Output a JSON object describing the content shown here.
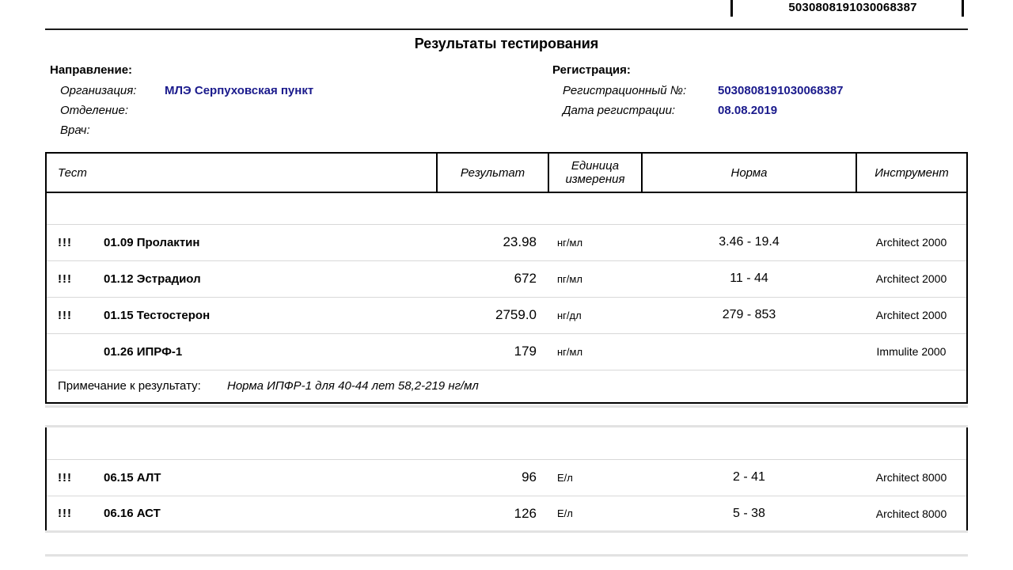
{
  "document": {
    "title": "Результаты тестирования",
    "barcode_number": "5030808191030068387",
    "accent_color": "#1a1a8c"
  },
  "referral": {
    "heading": "Направление:",
    "fields": [
      {
        "label": "Организация:",
        "value": "МЛЭ Серпуховская пункт"
      },
      {
        "label": "Отделение:",
        "value": ""
      },
      {
        "label": "Врач:",
        "value": ""
      }
    ]
  },
  "registration": {
    "heading": "Регистрация:",
    "fields": [
      {
        "label": "Регистрационный №:",
        "value": "5030808191030068387"
      },
      {
        "label": "Дата регистрации:",
        "value": "08.08.2019"
      }
    ]
  },
  "table": {
    "columns": [
      "Тест",
      "Результат",
      "Единица измерения",
      "Норма",
      "Инструмент"
    ],
    "groups": [
      {
        "group_label": "",
        "rows": [
          {
            "flag": "!!!",
            "test": "01.09 Пролактин",
            "result": "23.98",
            "unit": "нг/мл",
            "norm": "3.46 - 19.4",
            "instrument": "Architect 2000"
          },
          {
            "flag": "!!!",
            "test": "01.12 Эстрадиол",
            "result": "672",
            "unit": "пг/мл",
            "norm": "11 - 44",
            "instrument": "Architect 2000"
          },
          {
            "flag": "!!!",
            "test": "01.15 Тестостерон",
            "result": "2759.0",
            "unit": "нг/дл",
            "norm": "279 - 853",
            "instrument": "Architect 2000"
          },
          {
            "flag": "",
            "test": "01.26 ИПРФ-1",
            "result": "179",
            "unit": "нг/мл",
            "norm": "",
            "instrument": "Immulite 2000"
          }
        ],
        "note": {
          "label": "Примечание к результату:",
          "text": "Норма ИПФР-1 для 40-44 лет 58,2-219 нг/мл"
        }
      },
      {
        "group_label": "",
        "rows": [
          {
            "flag": "!!!",
            "test": "06.15 АЛТ",
            "result": "96",
            "unit": "Е/л",
            "norm": "2 - 41",
            "instrument": "Architect 8000"
          },
          {
            "flag": "!!!",
            "test": "06.16 АСТ",
            "result": "126",
            "unit": "Е/л",
            "norm": "5 - 38",
            "instrument": "Architect 8000"
          }
        ]
      }
    ]
  }
}
